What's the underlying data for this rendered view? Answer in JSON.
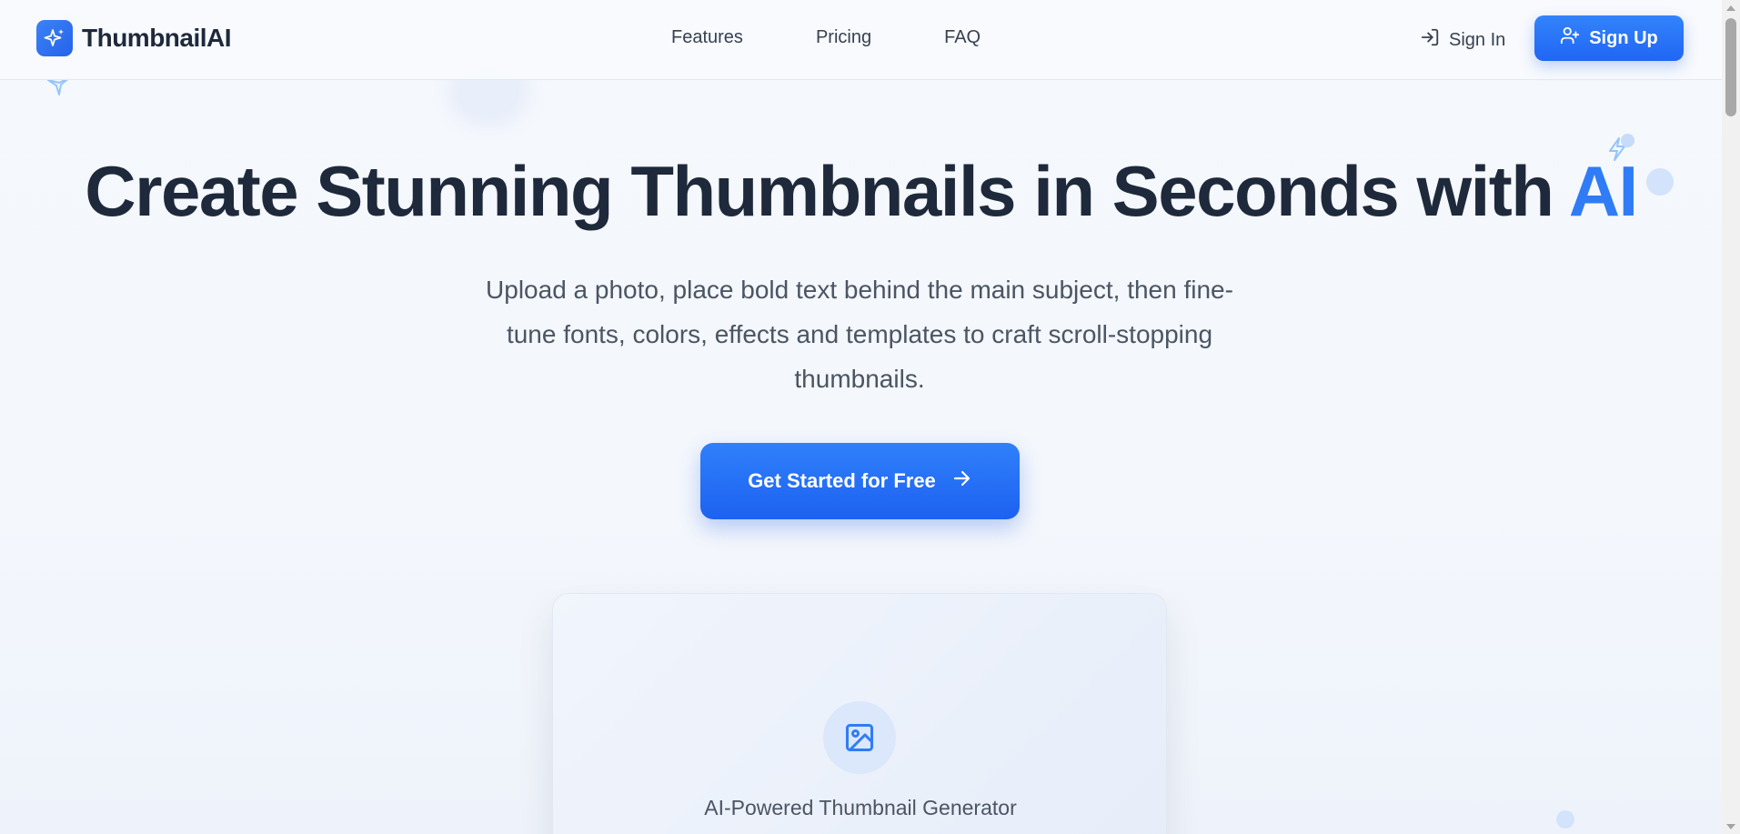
{
  "brand": {
    "name": "ThumbnailAI",
    "icon": "sparkles-icon",
    "color": "#2563eb"
  },
  "nav": {
    "items": [
      {
        "label": "Features"
      },
      {
        "label": "Pricing"
      },
      {
        "label": "FAQ"
      }
    ]
  },
  "auth": {
    "sign_in_label": "Sign In",
    "sign_in_icon": "log-in-icon",
    "sign_up_label": "Sign Up",
    "sign_up_icon": "user-plus-icon"
  },
  "hero": {
    "title_main": "Create Stunning Thumbnails in Seconds with ",
    "title_accent": "AI",
    "accent_color": "#2f7cf6",
    "subtitle": "Upload a photo, place bold text behind the main subject, then fine-tune fonts, colors, effects and templates to craft scroll-stopping thumbnails.",
    "cta_label": "Get Started for Free",
    "cta_icon": "arrow-right-icon"
  },
  "preview": {
    "icon": "image-icon",
    "label": "AI-Powered Thumbnail Generator"
  }
}
